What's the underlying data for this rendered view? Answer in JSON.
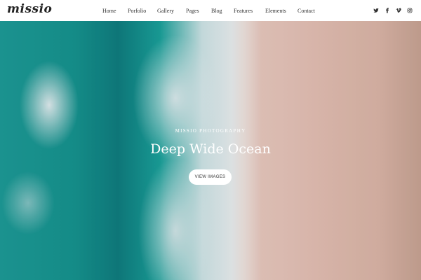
{
  "brand": {
    "logo_text": "missio"
  },
  "nav": {
    "items": [
      "Home",
      "Porfolio",
      "Gallery",
      "Pages",
      "Blog",
      "Features",
      "Elements",
      "Contact"
    ]
  },
  "social": {
    "icons": [
      "twitter-icon",
      "facebook-icon",
      "vimeo-icon",
      "instagram-icon"
    ]
  },
  "hero": {
    "eyebrow": "MISSIO PHOTOGRAPHY",
    "title": "Deep Wide Ocean",
    "cta_label": "VIEW IMAGES"
  },
  "colors": {
    "ocean": "#169490",
    "sand": "#e5c0b4",
    "header_bg": "#ffffff",
    "text_dark": "#333333"
  }
}
